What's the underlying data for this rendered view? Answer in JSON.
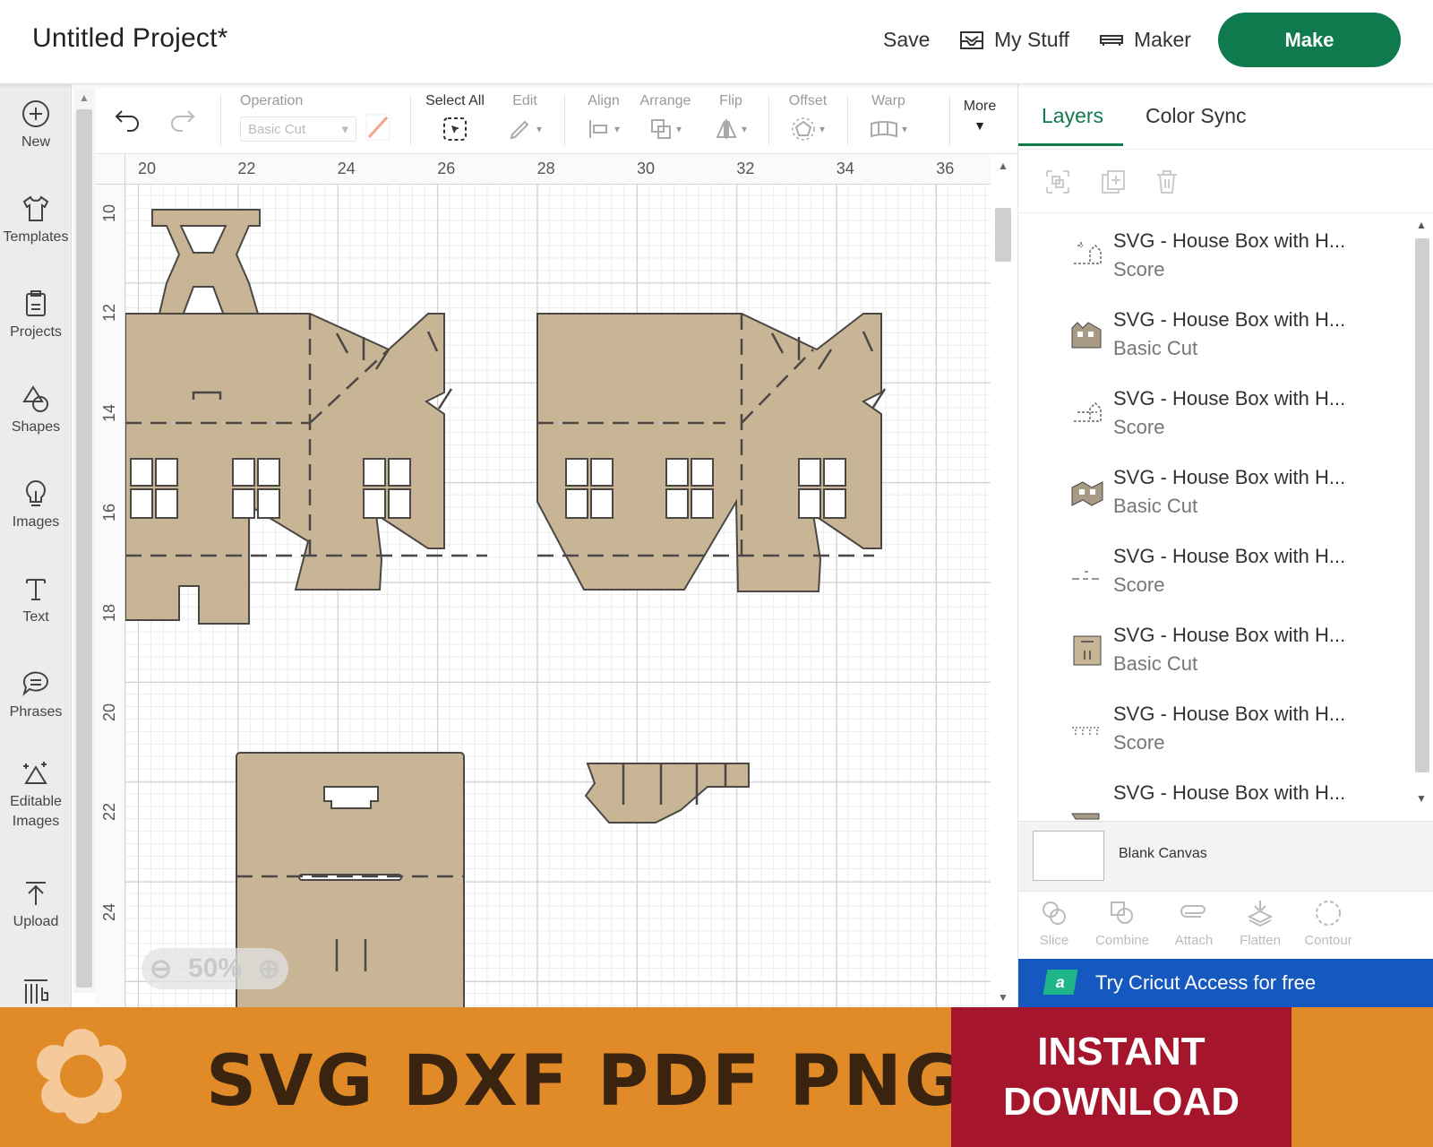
{
  "header": {
    "title": "Untitled Project*",
    "save_label": "Save",
    "mystuff_label": "My Stuff",
    "maker_label": "Maker",
    "make_label": "Make"
  },
  "sidebar": {
    "items": [
      {
        "label": "New",
        "icon": "plus-circle-icon"
      },
      {
        "label": "Templates",
        "icon": "shirt-icon"
      },
      {
        "label": "Projects",
        "icon": "clipboard-icon"
      },
      {
        "label": "Shapes",
        "icon": "shapes-icon"
      },
      {
        "label": "Images",
        "icon": "lightbulb-icon"
      },
      {
        "label": "Text",
        "icon": "text-icon"
      },
      {
        "label": "Phrases",
        "icon": "speech-bubble-icon"
      },
      {
        "label": "Editable Images",
        "icon": "editable-image-icon"
      },
      {
        "label": "Upload",
        "icon": "upload-icon"
      }
    ]
  },
  "toolbar": {
    "operation_label": "Operation",
    "operation_value": "Basic Cut",
    "select_all_label": "Select All",
    "edit_label": "Edit",
    "align_label": "Align",
    "arrange_label": "Arrange",
    "flip_label": "Flip",
    "offset_label": "Offset",
    "warp_label": "Warp",
    "more_label": "More"
  },
  "canvas": {
    "ruler_x": [
      "20",
      "22",
      "24",
      "26",
      "28",
      "30",
      "32",
      "34",
      "36"
    ],
    "ruler_y": [
      "10",
      "12",
      "14",
      "16",
      "18",
      "20",
      "22",
      "24"
    ],
    "zoom_level": "50%",
    "shape_fill": "#c8b596",
    "shape_stroke": "#4a4744"
  },
  "panel": {
    "tabs": [
      "Layers",
      "Color Sync"
    ],
    "layers": [
      {
        "name": "SVG - House Box with H...",
        "operation": "Score"
      },
      {
        "name": "SVG - House Box with H...",
        "operation": "Basic Cut"
      },
      {
        "name": "SVG - House Box with H...",
        "operation": "Score"
      },
      {
        "name": "SVG - House Box with H...",
        "operation": "Basic Cut"
      },
      {
        "name": "SVG - House Box with H...",
        "operation": "Score"
      },
      {
        "name": "SVG - House Box with H...",
        "operation": "Basic Cut"
      },
      {
        "name": "SVG - House Box with H...",
        "operation": "Score"
      },
      {
        "name": "SVG - House Box with H...",
        "operation": ""
      }
    ],
    "blank_canvas_label": "Blank Canvas",
    "bottom_tools": [
      "Slice",
      "Combine",
      "Attach",
      "Flatten",
      "Contour"
    ],
    "access_logo": "a",
    "access_text": "Try Cricut Access for free"
  },
  "banner": {
    "formats": "SVG DXF PDF PNG",
    "cta_line1": "INSTANT",
    "cta_line2": "DOWNLOAD",
    "colors": {
      "background": "#e08a28",
      "cta": "#a5152c",
      "text": "#3a2410"
    }
  },
  "colors": {
    "brand_green": "#107a4f",
    "access_blue": "#1558c0"
  }
}
